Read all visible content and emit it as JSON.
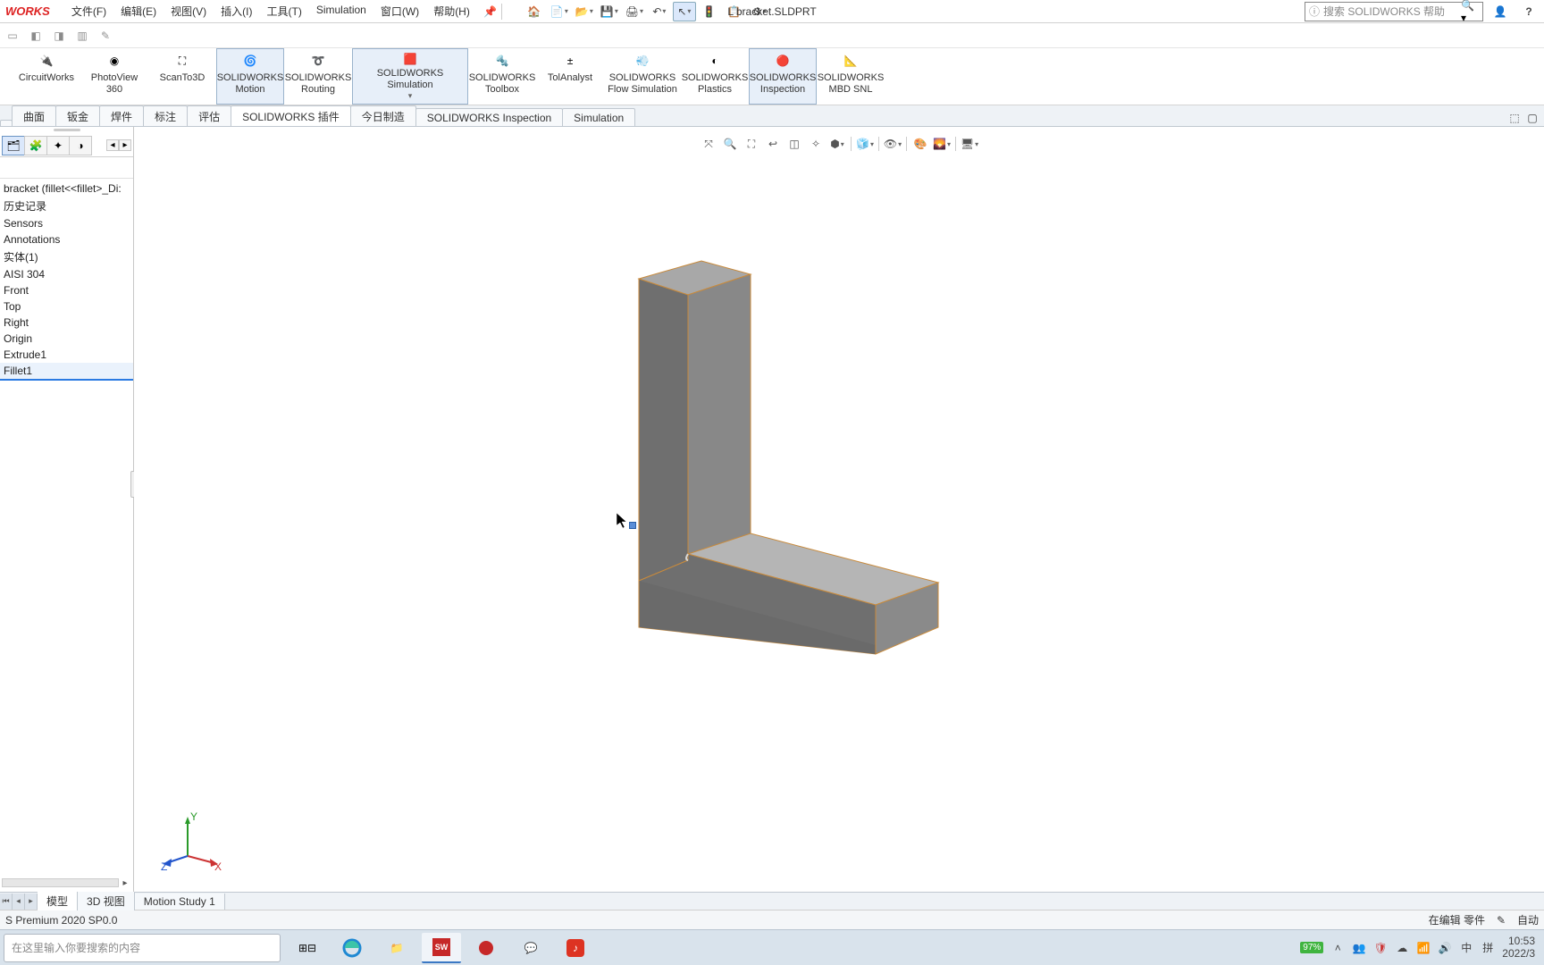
{
  "app": {
    "logo": "WORKS",
    "doc_title": "L bracket.SLDPRT"
  },
  "menu": [
    "文件(F)",
    "编辑(E)",
    "视图(V)",
    "插入(I)",
    "工具(T)",
    "Simulation",
    "窗口(W)",
    "帮助(H)"
  ],
  "search": {
    "placeholder": "搜索 SOLIDWORKS 帮助"
  },
  "ribbon": [
    {
      "label": "CircuitWorks",
      "sub": ""
    },
    {
      "label": "PhotoView",
      "sub": "360"
    },
    {
      "label": "ScanTo3D",
      "sub": ""
    },
    {
      "label": "SOLIDWORKS",
      "sub": "Motion"
    },
    {
      "label": "SOLIDWORKS",
      "sub": "Routing"
    },
    {
      "label": "SOLIDWORKS Simulation",
      "sub": ""
    },
    {
      "label": "SOLIDWORKS",
      "sub": "Toolbox"
    },
    {
      "label": "TolAnalyst",
      "sub": ""
    },
    {
      "label": "SOLIDWORKS",
      "sub": "Flow Simulation"
    },
    {
      "label": "SOLIDWORKS",
      "sub": "Plastics"
    },
    {
      "label": "SOLIDWORKS",
      "sub": "Inspection"
    },
    {
      "label": "SOLIDWORKS",
      "sub": "MBD SNL"
    }
  ],
  "tabs": [
    "曲面",
    "钣金",
    "焊件",
    "标注",
    "评估",
    "SOLIDWORKS 插件",
    "今日制造",
    "SOLIDWORKS Inspection",
    "Simulation"
  ],
  "tree": {
    "root": "bracket (fillet<<fillet>_Di:",
    "items": [
      "历史记录",
      "Sensors",
      "Annotations",
      "实体(1)",
      "AISI 304",
      "Front",
      "Top",
      "Right",
      "Origin",
      "Extrude1",
      "Fillet1"
    ]
  },
  "bottom_tabs": [
    "模型",
    "3D 视图",
    "Motion Study 1"
  ],
  "status": {
    "left": "S Premium 2020 SP0.0",
    "edit": "在编辑 零件",
    "auto": "自动"
  },
  "taskbar": {
    "search_placeholder": "在这里输入你要搜索的内容",
    "battery": "97%",
    "ime1": "中",
    "ime2": "拼",
    "time": "10:53",
    "date": "2022/3"
  },
  "triad": {
    "x": "X",
    "y": "Y",
    "z": "Z"
  }
}
